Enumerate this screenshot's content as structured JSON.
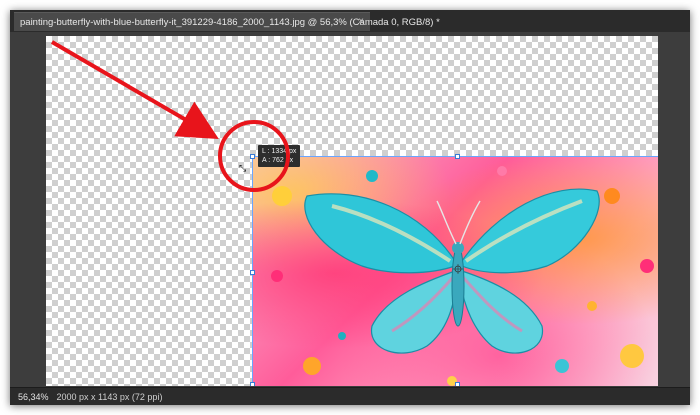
{
  "document_tab": {
    "title": "painting-butterfly-with-blue-butterfly-it_391229-4186_2000_1143.jpg @ 56,3% (Camada 0, RGB/8) *",
    "close_label": "×"
  },
  "transform_readout": {
    "line1": "L : 1334 px",
    "line2": "A : 762 px"
  },
  "statusbar": {
    "zoom": "56,34%",
    "doc_info": "2000 px x 1143 px (72 ppi)"
  },
  "icons": {
    "cursor": "move-cursor-icon",
    "arrow": "red-arrow-annotation",
    "circle": "red-circle-annotation"
  },
  "colors": {
    "annotation_red": "#e8141b",
    "selection_blue": "#6aa5ff",
    "workspace_bg": "#3d3d3d"
  }
}
